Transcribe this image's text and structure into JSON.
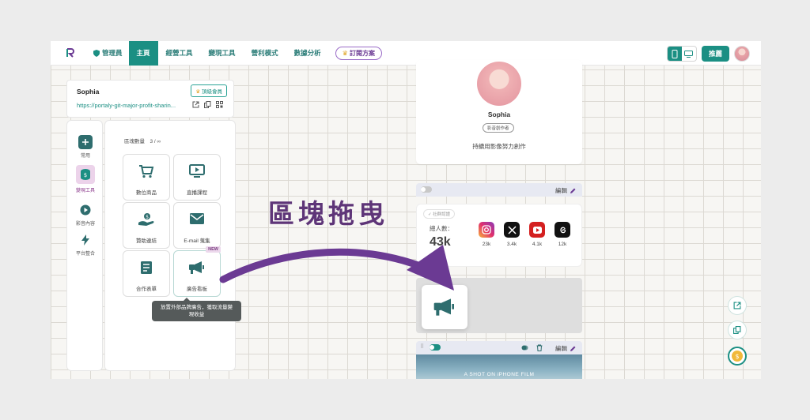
{
  "nav": {
    "admin_label": "管理員",
    "items": [
      {
        "label": "主頁",
        "active": true
      },
      {
        "label": "經營工具",
        "active": false
      },
      {
        "label": "變現工具",
        "active": false
      },
      {
        "label": "營利模式",
        "active": false
      },
      {
        "label": "數據分析",
        "active": false
      }
    ],
    "plan_label": "訂閱方案",
    "publish_label": "推薦"
  },
  "profile": {
    "name": "Sophia",
    "badge": "頂級會員",
    "url": "https://portaly-git-major-profit-sharin..."
  },
  "rail": [
    {
      "label": "常用",
      "icon": "plus-icon"
    },
    {
      "label": "變現工具",
      "icon": "money-icon",
      "active": true
    },
    {
      "label": "影音內容",
      "icon": "play-icon"
    },
    {
      "label": "平台整合",
      "icon": "bolt-icon"
    }
  ],
  "panel": {
    "count_label": "區塊數量　3 / ∞",
    "tiles": [
      {
        "label": "數位商品",
        "icon": "cart-icon"
      },
      {
        "label": "直播課程",
        "icon": "live-icon"
      },
      {
        "label": "贊助連結",
        "icon": "donate-icon"
      },
      {
        "label": "E-mail 蒐集",
        "icon": "mail-icon"
      },
      {
        "label": "合作表單",
        "icon": "form-icon"
      },
      {
        "label": "廣告看板",
        "icon": "megaphone-icon",
        "new": "NEW"
      }
    ],
    "tooltip": "放置外部品牌廣告，獲取流量變現收益"
  },
  "headline": "區塊拖曳",
  "preview": {
    "name": "Sophia",
    "role": "影音創作者",
    "bio": "持續用影像努力創作",
    "edit_label": "編輯",
    "verify_label": "社群認證",
    "fans_label": "總人數：",
    "fans_total": "43k",
    "socials": [
      {
        "name": "instagram-icon",
        "count": "23k",
        "color": "#d6336c"
      },
      {
        "name": "x-icon",
        "count": "3.4k",
        "color": "#111111"
      },
      {
        "name": "youtube-icon",
        "count": "4.1k",
        "color": "#d42020"
      },
      {
        "name": "threads-icon",
        "count": "12k",
        "color": "#111111"
      }
    ],
    "video_caption": "A SHOT ON iPHONE FILM"
  },
  "colors": {
    "accent": "#1b8f83",
    "purple": "#6b3a93"
  }
}
